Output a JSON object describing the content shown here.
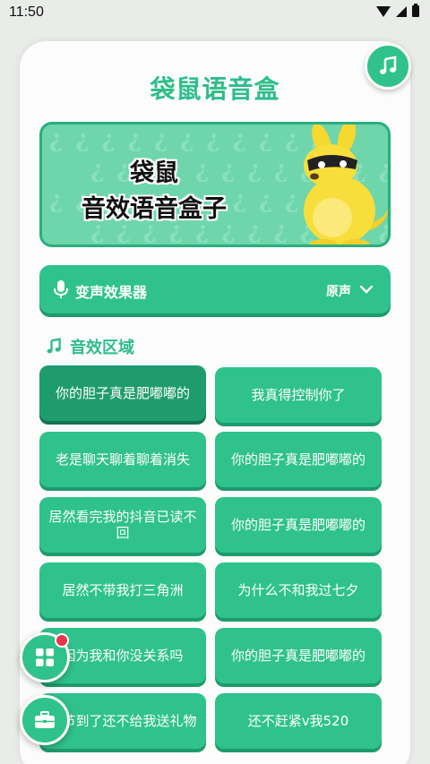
{
  "status": {
    "time": "11:50"
  },
  "app": {
    "title": "袋鼠语音盒"
  },
  "banner": {
    "line1": "袋鼠",
    "line2": "音效语音盒子",
    "pattern_glyph": "¿"
  },
  "voice_changer": {
    "label": "变声效果器",
    "value": "原声"
  },
  "section": {
    "title": "音效区域"
  },
  "sounds": [
    {
      "label": "你的胆子真是肥嘟嘟的",
      "active": true
    },
    {
      "label": "我真得控制你了",
      "active": false
    },
    {
      "label": "老是聊天聊着聊着消失",
      "active": false
    },
    {
      "label": "你的胆子真是肥嘟嘟的",
      "active": false
    },
    {
      "label": "居然看完我的抖音已读不回",
      "active": false
    },
    {
      "label": "你的胆子真是肥嘟嘟的",
      "active": false
    },
    {
      "label": "居然不带我打三角洲",
      "active": false
    },
    {
      "label": "为什么不和我过七夕",
      "active": false
    },
    {
      "label": "因为我和你没关系吗",
      "active": false
    },
    {
      "label": "你的胆子真是肥嘟嘟的",
      "active": false
    },
    {
      "label": "夕节到了还不给我送礼物",
      "active": false
    },
    {
      "label": "还不赶紧v我520",
      "active": false
    }
  ],
  "icons": {
    "music_fab": "music-note-icon",
    "mic": "microphone-icon",
    "chevron": "chevron-down-icon",
    "section": "music-note-icon",
    "grid_fab": "grid-icon",
    "toolbox_fab": "toolbox-icon"
  },
  "colors": {
    "accent": "#2fc28c",
    "accent_dark": "#1f9c6e",
    "title": "#2ebd8a",
    "badge": "#e8344c"
  }
}
